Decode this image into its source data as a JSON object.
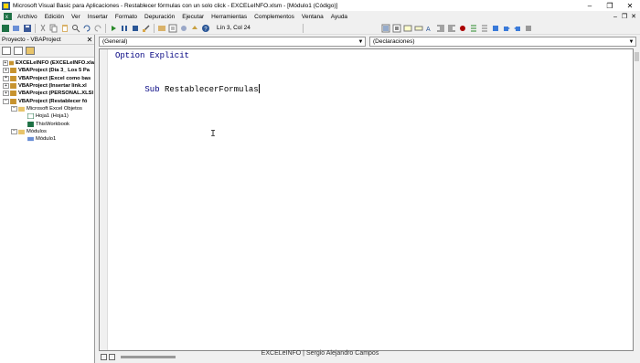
{
  "window": {
    "title": "Microsoft Visual Basic para Aplicaciones - Restablecer fórmulas con un solo click - EXCELeINFO.xlsm - [Módulo1 (Código)]",
    "minimize": "–",
    "maximize": "❐",
    "close": "✕"
  },
  "menu": {
    "items": [
      "Archivo",
      "Edición",
      "Ver",
      "Insertar",
      "Formato",
      "Depuración",
      "Ejecutar",
      "Herramientas",
      "Complementos",
      "Ventana",
      "Ayuda"
    ],
    "mdi_minimize": "–",
    "mdi_restore": "❐",
    "mdi_close": "✕"
  },
  "toolbar": {
    "position": "Lín 3, Col 24"
  },
  "project": {
    "title": "Proyecto - VBAProject",
    "close": "✕",
    "nodes": [
      {
        "label": "EXCELeINFO (EXCELeINFO.xla",
        "bold": true,
        "exp": "+",
        "indent": 0
      },
      {
        "label": "VBAProject (Día 3_ Los 5 Pa",
        "bold": true,
        "exp": "+",
        "indent": 0
      },
      {
        "label": "VBAProject (Excel como bas",
        "bold": true,
        "exp": "+",
        "indent": 0
      },
      {
        "label": "VBAProject (Insertar link.xl",
        "bold": true,
        "exp": "+",
        "indent": 0
      },
      {
        "label": "VBAProject (PERSONAL.XLSI",
        "bold": true,
        "exp": "+",
        "indent": 0
      },
      {
        "label": "VBAProject (Restablecer fó",
        "bold": true,
        "exp": "−",
        "indent": 0
      },
      {
        "label": "Microsoft Excel Objetos",
        "bold": false,
        "exp": "−",
        "indent": 1
      },
      {
        "label": "Hoja1 (Hoja1)",
        "bold": false,
        "exp": "",
        "indent": 2
      },
      {
        "label": "ThisWorkbook",
        "bold": false,
        "exp": "",
        "indent": 2
      },
      {
        "label": "Módulos",
        "bold": false,
        "exp": "−",
        "indent": 1
      },
      {
        "label": "Módulo1",
        "bold": false,
        "exp": "",
        "indent": 2
      }
    ]
  },
  "editor": {
    "object_combo": "(General)",
    "proc_combo": "(Declaraciones)",
    "line1_kw": "Option Explicit",
    "line2_kw": "Sub",
    "line2_name": " RestablecerFormulas"
  },
  "footer": {
    "credit": "EXCELeINFO | Sergio Alejandro Campos"
  },
  "colors": {
    "keyword": "#000080",
    "excel_green": "#1e7145"
  }
}
